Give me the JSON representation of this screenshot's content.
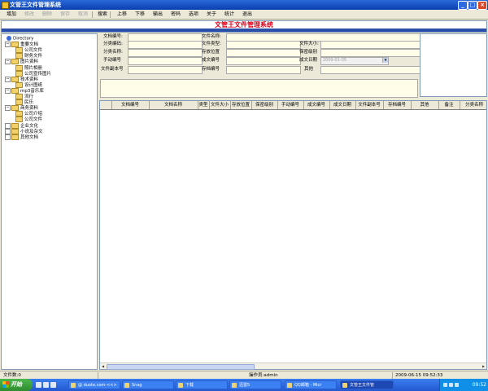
{
  "window": {
    "title": "文管王文件管理系统",
    "controls": [
      "_",
      "□",
      "×"
    ]
  },
  "toolbar": [
    {
      "label": "增加",
      "enabled": true
    },
    {
      "label": "修改",
      "enabled": false
    },
    {
      "label": "删除",
      "enabled": false
    },
    {
      "label": "保存",
      "enabled": false
    },
    {
      "label": "取消",
      "enabled": false
    },
    {
      "label": "搜索",
      "enabled": true
    },
    {
      "label": "上移",
      "enabled": true
    },
    {
      "label": "下移",
      "enabled": true
    },
    {
      "label": "输出",
      "enabled": true
    },
    {
      "label": "密码",
      "enabled": true
    },
    {
      "label": "选项",
      "enabled": true
    },
    {
      "label": "关于",
      "enabled": true
    },
    {
      "label": "统计",
      "enabled": true
    },
    {
      "label": "退出",
      "enabled": true
    }
  ],
  "banner": {
    "title": "文管王文件管理系统"
  },
  "tree": [
    {
      "label": "Directory",
      "level": 0,
      "type": "root"
    },
    {
      "label": "重要文档",
      "level": 1,
      "expand": "−"
    },
    {
      "label": "公司文件",
      "level": 2
    },
    {
      "label": "财务文件",
      "level": 2
    },
    {
      "label": "图片资料",
      "level": 1,
      "expand": "−"
    },
    {
      "label": "照片相册",
      "level": 2
    },
    {
      "label": "公司宣传图片",
      "level": 2
    },
    {
      "label": "技术资料",
      "level": 1,
      "expand": "−"
    },
    {
      "label": "设计图纸",
      "level": 2
    },
    {
      "label": "mp3音乐库",
      "level": 1,
      "expand": "−"
    },
    {
      "label": "流行",
      "level": 2
    },
    {
      "label": "民乐",
      "level": 2
    },
    {
      "label": "商务资料",
      "level": 1,
      "expand": "−"
    },
    {
      "label": "公司介绍",
      "level": 2
    },
    {
      "label": "公司文件",
      "level": 2
    },
    {
      "label": "企业文化",
      "level": 1
    },
    {
      "label": "小说及杂文",
      "level": 1
    },
    {
      "label": "其他文档",
      "level": 1
    }
  ],
  "form": {
    "doc_no": "文档编号:",
    "file_name": "文件名称:",
    "category_no": "分类编码:",
    "file_type": "文件类型:",
    "file_size": "文件大小:",
    "category_name": "分类名称:",
    "storage_location": "存放位置",
    "secret_level": "保密级别",
    "manual_no": "手动编号",
    "doc_no2": "成文编号",
    "doc_date": "成文日期",
    "doc_date_value": "2009-01-05",
    "file_copy_no": "文件副本号",
    "storage_no": "存档编号",
    "other": "其他"
  },
  "grid": {
    "columns": [
      "文档编号",
      "文档名称",
      "类型",
      "文件大小",
      "存放位置",
      "保密级别",
      "手动编号",
      "成文编号",
      "成文日期",
      "文件副本号",
      "存档编号",
      "其他",
      "备注",
      "分类名称"
    ]
  },
  "status": {
    "count": "文件数:0",
    "operator": "操作员:admin",
    "datetime": "2009-06-15 09:52:33"
  },
  "taskbar": {
    "start": "开始",
    "tasks": [
      {
        "label": "@ duote.com-<<>",
        "active": false
      },
      {
        "label": "Snag",
        "active": false
      },
      {
        "label": "下载",
        "active": false
      },
      {
        "label": "迅雷5",
        "active": false
      },
      {
        "label": "QQ邮箱 - Micr",
        "active": false
      },
      {
        "label": "文管王文件管",
        "active": true
      }
    ],
    "clock": "09:52"
  }
}
